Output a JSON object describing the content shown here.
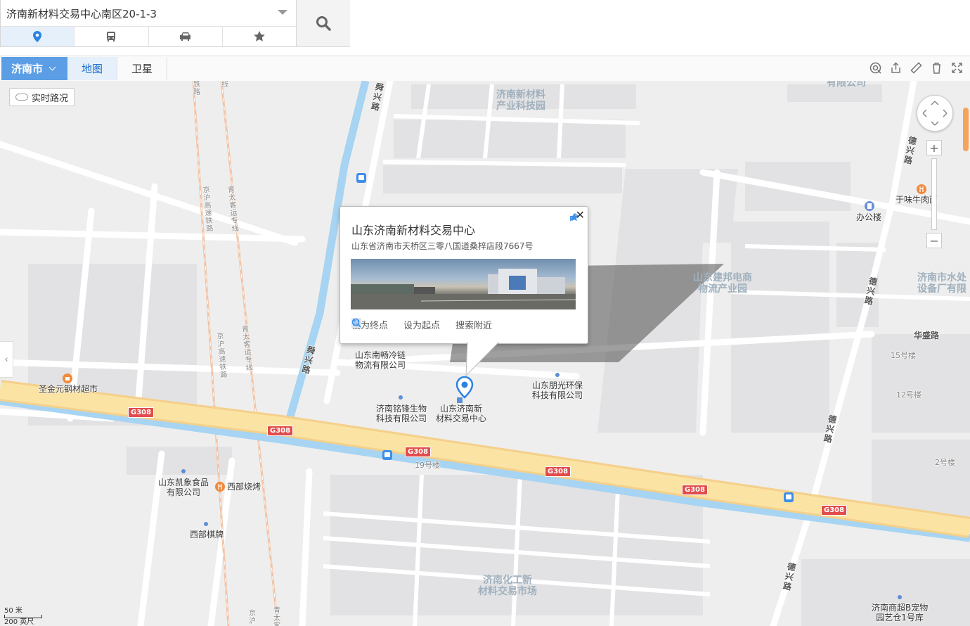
{
  "search": {
    "query": "济南新材料交易中心南区20-1-3",
    "tabs": [
      "place-icon",
      "bus-icon",
      "car-icon",
      "star-icon"
    ]
  },
  "toolbar": {
    "city": "济南市",
    "map_tab": "地图",
    "sat_tab": "卫星",
    "tools": [
      "measure-icon",
      "share-icon",
      "ruler-icon",
      "trash-icon",
      "fullscreen-icon"
    ]
  },
  "map": {
    "traffic": "实时路况",
    "scale_top": "50 米",
    "scale_bottom": "200 英尺",
    "labels": {
      "park1": "济南新材料\n产业科技园",
      "co_top": "有限公司",
      "yuwei": "于味牛肉面",
      "office": "办公楼",
      "jianbang": "山东建邦电商\n物流产业园",
      "shuiwu": "济南市水处\n设备厂有限",
      "huasheng": "华盛路",
      "b15": "15号楼",
      "b12": "12号楼",
      "b2": "2号楼",
      "b19": "19号楼",
      "nanchang": "山东南畅冷链\n物流有限公司",
      "pengguang": "山东朋光环保\n科技有限公司",
      "mingfeng": "济南铭锋生物\n科技有限公司",
      "center": "山东济南新\n材料交易中心",
      "shengjin": "圣金元钢材超市",
      "kaixiang": "山东凯象食品\n有限公司",
      "xibushao": "西部烧烤",
      "qipai": "西部棋牌",
      "huagong": "济南化工新\n材料交易市场",
      "pet": "济南商超B宠物\n园艺仓1号库",
      "shunxing1": "舜兴路",
      "shunxing2": "舜兴路",
      "dexing1": "德兴路",
      "dexing2": "德兴路",
      "dexing3": "德兴路",
      "dexing4": "德兴路",
      "rail1": "京沪高速铁路",
      "rail2": "青太客运专线",
      "rail3": "京沪高速铁路",
      "rail4": "青太客运专线",
      "rail5": "京沪",
      "rail6": "青太客",
      "rail7": "铁路",
      "rail8": "线"
    },
    "shields": [
      "G308",
      "G308",
      "G308",
      "G308",
      "G308",
      "G308"
    ]
  },
  "popup": {
    "title": "山东济南新材料交易中心",
    "address": "山东省济南市天桥区三零八国道桑梓店段7667号",
    "set_end": "设为终点",
    "set_start": "设为起点",
    "search_nearby": "搜索附近",
    "end_badge": "终",
    "start_badge": "起"
  }
}
